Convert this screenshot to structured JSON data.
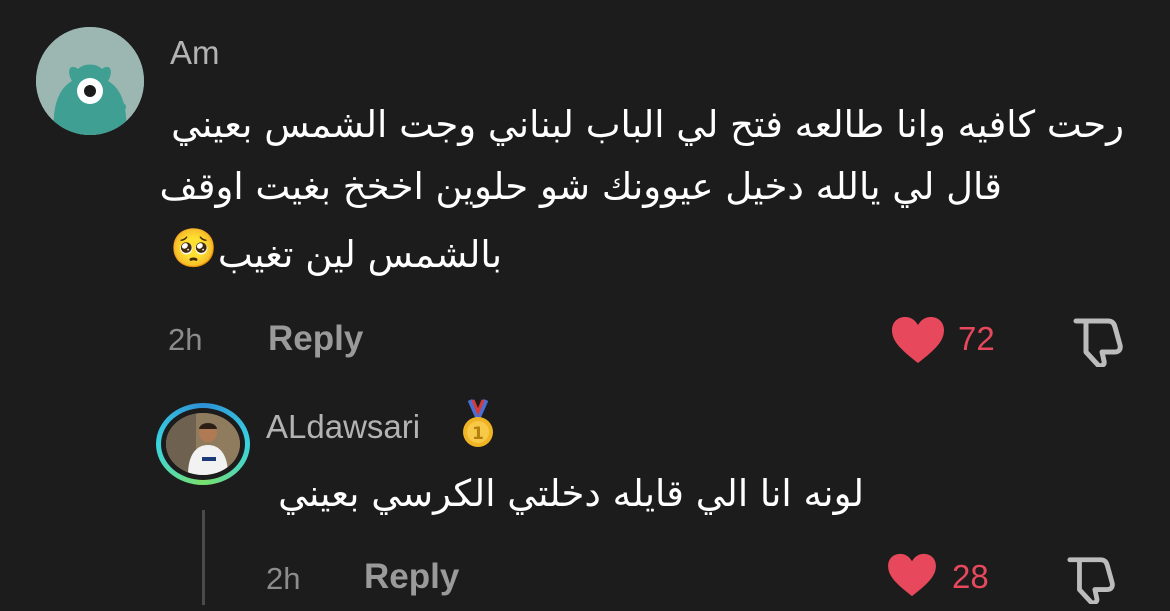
{
  "comment": {
    "username": "Am",
    "lines": [
      "رحت كافيه وانا طالعه فتح لي الباب لبناني وجت الشمس بعيني",
      "قال لي يالله دخيل عيوونك شو حلوين اخخخ بغيت اوقف",
      "بالشمس لين تغيب"
    ],
    "emoji": "🥺",
    "time": "2h",
    "reply_label": "Reply",
    "likes": "72",
    "like_color": "#e8485b"
  },
  "reply": {
    "username": "ALdawsari",
    "medal": "🥇",
    "text": "لونه انا الي قايله دخلتي الكرسي بعيني",
    "time": "2h",
    "reply_label": "Reply",
    "likes": "28",
    "like_color": "#e8485b"
  },
  "icons": {
    "like": "heart-icon",
    "dislike": "thumbs-down-icon",
    "medal": "gold-medal-icon"
  }
}
